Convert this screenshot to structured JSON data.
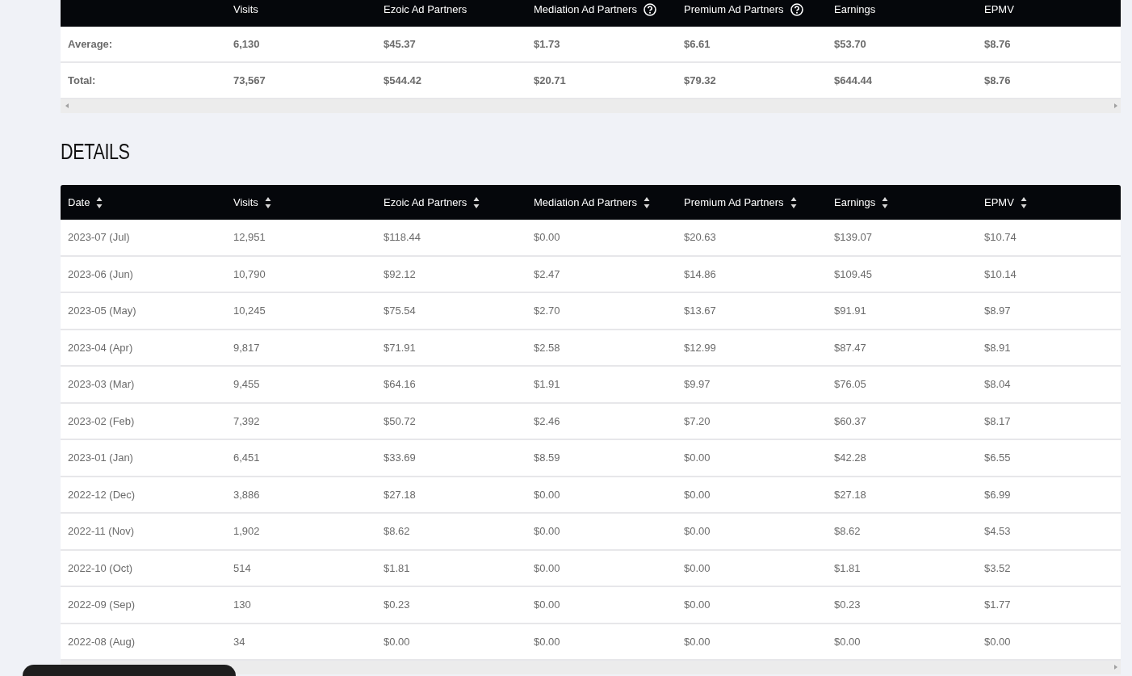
{
  "summary": {
    "columns": [
      {
        "help": false
      },
      {
        "label": "Visits",
        "help": false
      },
      {
        "label": "Ezoic Ad Partners",
        "help": false
      },
      {
        "label": "Mediation Ad Partners",
        "help": true
      },
      {
        "label": "Premium Ad Partners",
        "help": true
      },
      {
        "label": "Earnings",
        "help": false
      },
      {
        "label": "EPMV",
        "help": false
      }
    ],
    "rows": [
      {
        "cells": [
          "Average:",
          "6,130",
          "$45.37",
          "$1.73",
          "$6.61",
          "$53.70",
          "$8.76"
        ]
      },
      {
        "cells": [
          "Total:",
          "73,567",
          "$544.42",
          "$20.71",
          "$79.32",
          "$644.44",
          "$8.76"
        ]
      }
    ]
  },
  "details": {
    "title": "DETAILS",
    "columns": [
      {
        "label": "Date",
        "sortable": true
      },
      {
        "label": "Visits",
        "sortable": true
      },
      {
        "label": "Ezoic Ad Partners",
        "sortable": true
      },
      {
        "label": "Mediation Ad Partners",
        "sortable": true
      },
      {
        "label": "Premium Ad Partners",
        "sortable": true
      },
      {
        "label": "Earnings",
        "sortable": true
      },
      {
        "label": "EPMV",
        "sortable": true
      }
    ],
    "rows": [
      {
        "cells": [
          "2023-07 (Jul)",
          "12,951",
          "$118.44",
          "$0.00",
          "$20.63",
          "$139.07",
          "$10.74"
        ]
      },
      {
        "cells": [
          "2023-06 (Jun)",
          "10,790",
          "$92.12",
          "$2.47",
          "$14.86",
          "$109.45",
          "$10.14"
        ]
      },
      {
        "cells": [
          "2023-05 (May)",
          "10,245",
          "$75.54",
          "$2.70",
          "$13.67",
          "$91.91",
          "$8.97"
        ]
      },
      {
        "cells": [
          "2023-04 (Apr)",
          "9,817",
          "$71.91",
          "$2.58",
          "$12.99",
          "$87.47",
          "$8.91"
        ]
      },
      {
        "cells": [
          "2023-03 (Mar)",
          "9,455",
          "$64.16",
          "$1.91",
          "$9.97",
          "$76.05",
          "$8.04"
        ]
      },
      {
        "cells": [
          "2023-02 (Feb)",
          "7,392",
          "$50.72",
          "$2.46",
          "$7.20",
          "$60.37",
          "$8.17"
        ]
      },
      {
        "cells": [
          "2023-01 (Jan)",
          "6,451",
          "$33.69",
          "$8.59",
          "$0.00",
          "$42.28",
          "$6.55"
        ]
      },
      {
        "cells": [
          "2022-12 (Dec)",
          "3,886",
          "$27.18",
          "$0.00",
          "$0.00",
          "$27.18",
          "$6.99"
        ]
      },
      {
        "cells": [
          "2022-11 (Nov)",
          "1,902",
          "$8.62",
          "$0.00",
          "$0.00",
          "$8.62",
          "$4.53"
        ]
      },
      {
        "cells": [
          "2022-10 (Oct)",
          "514",
          "$1.81",
          "$0.00",
          "$0.00",
          "$1.81",
          "$3.52"
        ]
      },
      {
        "cells": [
          "2022-09 (Sep)",
          "130",
          "$0.23",
          "$0.00",
          "$0.00",
          "$0.23",
          "$1.77"
        ]
      },
      {
        "cells": [
          "2022-08 (Aug)",
          "34",
          "$0.00",
          "$0.00",
          "$0.00",
          "$0.00",
          "$0.00"
        ]
      }
    ]
  }
}
